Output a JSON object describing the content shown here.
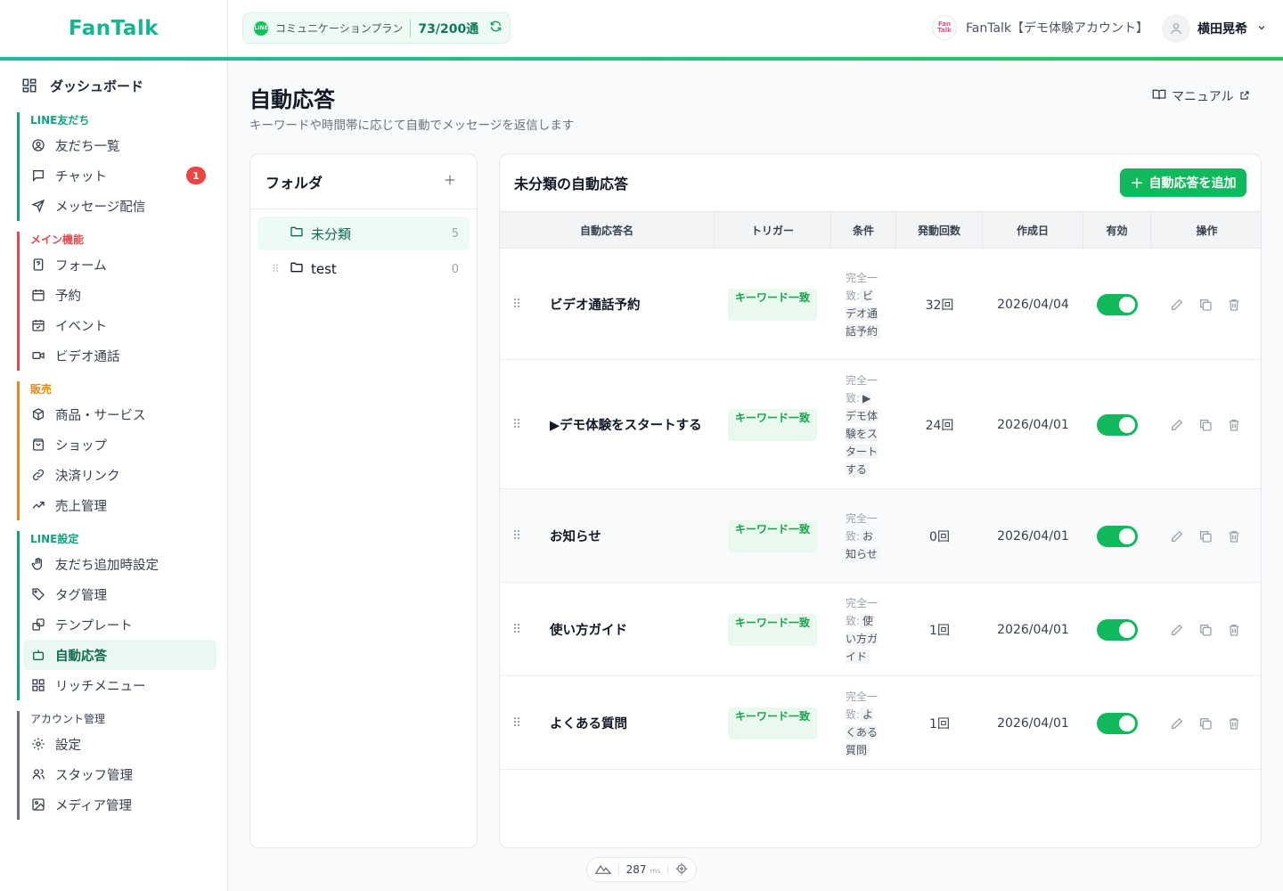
{
  "header": {
    "logo": "FanTalk",
    "plan": {
      "label": "コミュニケーションプラン",
      "count": "73/200通",
      "line_badge": "LINE"
    },
    "account": {
      "logo_text": "Fan Talk",
      "name": "FanTalk【デモ体験アカウント】"
    },
    "user": {
      "name": "横田晃希"
    }
  },
  "sidebar": {
    "dashboard": "ダッシュボード",
    "sections": [
      {
        "label": "LINE友だち",
        "color": "#10a37f",
        "items": [
          "友だち一覧",
          "チャット",
          "メッセージ配信"
        ]
      },
      {
        "label": "メイン機能",
        "color": "#e5484d",
        "items": [
          "フォーム",
          "予約",
          "イベント",
          "ビデオ通話"
        ]
      },
      {
        "label": "販売",
        "color": "#e58a1f",
        "items": [
          "商品・サービス",
          "ショップ",
          "決済リンク",
          "売上管理"
        ]
      },
      {
        "label": "LINE設定",
        "color": "#10a37f",
        "items": [
          "友だち追加時設定",
          "タグ管理",
          "テンプレート",
          "自動応答",
          "リッチメニュー"
        ]
      },
      {
        "label": "アカウント管理",
        "color": "#6b7280",
        "items": [
          "設定",
          "スタッフ管理",
          "メディア管理"
        ]
      }
    ],
    "chat_badge": "1",
    "active": "自動応答"
  },
  "page": {
    "title": "自動応答",
    "subtitle": "キーワードや時間帯に応じて自動でメッセージを返信します",
    "manual": "マニュアル"
  },
  "folders": {
    "title": "フォルダ",
    "items": [
      {
        "name": "未分類",
        "count": "5"
      },
      {
        "name": "test",
        "count": "0"
      }
    ]
  },
  "list": {
    "title": "未分類の自動応答",
    "add_button": "自動応答を追加",
    "columns": [
      "自動応答名",
      "トリガー",
      "条件",
      "発動回数",
      "作成日",
      "有効",
      "操作"
    ],
    "rows": [
      {
        "name": "ビデオ通話予約",
        "trigger": "キーワード一致",
        "cond_label": "完全一致:",
        "cond_kw": "ビデオ通話予約",
        "count": "32回",
        "date": "2026/04/04",
        "enabled": true
      },
      {
        "name": "▶デモ体験をスタートする",
        "trigger": "キーワード一致",
        "cond_label": "完全一致:",
        "cond_kw": "▶デモ体験をスタートする",
        "count": "24回",
        "date": "2026/04/01",
        "enabled": true
      },
      {
        "name": "お知らせ",
        "trigger": "キーワード一致",
        "cond_label": "完全一致:",
        "cond_kw": "お知らせ",
        "count": "0回",
        "date": "2026/04/01",
        "enabled": true
      },
      {
        "name": "使い方ガイド",
        "trigger": "キーワード一致",
        "cond_label": "完全一致:",
        "cond_kw": "使い方ガイド",
        "count": "1回",
        "date": "2026/04/01",
        "enabled": true
      },
      {
        "name": "よくある質問",
        "trigger": "キーワード一致",
        "cond_label": "完全一致:",
        "cond_kw": "よくある質問",
        "count": "1回",
        "date": "2026/04/01",
        "enabled": true
      }
    ]
  },
  "perf": {
    "value": "287",
    "unit": "ms"
  }
}
